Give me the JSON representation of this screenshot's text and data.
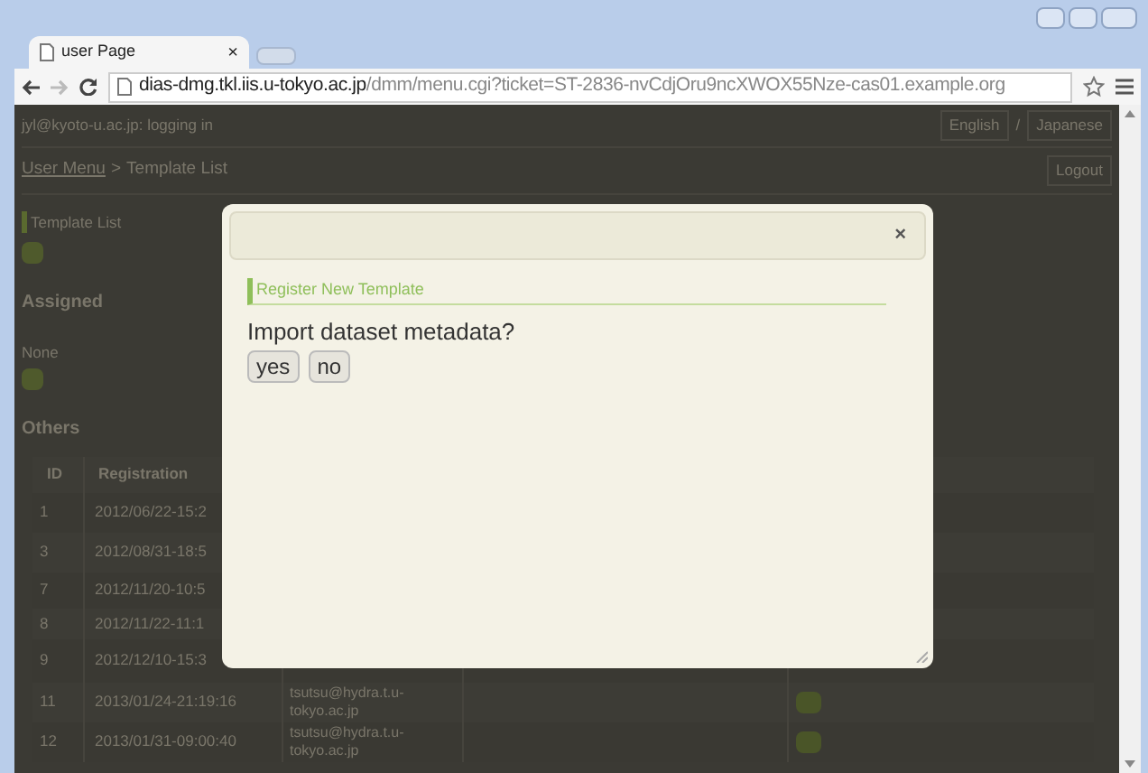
{
  "browser": {
    "tab": {
      "title": "user Page",
      "close": "×"
    },
    "url": {
      "host": "dias-dmg.tkl.iis.u-tokyo.ac.jp",
      "path": "/dmm/menu.cgi?ticket=ST-2836-nvCdjOru9ncXWOX55Nze-cas01.example.org"
    }
  },
  "page": {
    "login": "jyl@kyoto-u.ac.jp: logging in",
    "languages": [
      "English",
      "Japanese"
    ],
    "language_separator": "/",
    "breadcrumb": {
      "link": "User Menu",
      "separator": ">",
      "current": "Template List"
    },
    "logout": "Logout",
    "section_title": "Template List",
    "assigned": {
      "heading": "Assigned",
      "text": "None"
    },
    "others": {
      "heading": "Others",
      "columns": [
        "ID",
        "Registration"
      ],
      "rows": [
        {
          "id": "1",
          "date": "2012/06/22-15:2"
        },
        {
          "id": "3",
          "date": "2012/08/31-18:5"
        },
        {
          "id": "7",
          "date": "2012/11/20-10:5"
        },
        {
          "id": "8",
          "date": "2012/11/22-11:1"
        },
        {
          "id": "9",
          "date": "2012/12/10-15:3"
        },
        {
          "id": "11",
          "date": "2013/01/24-21:19:16",
          "user": "tsutsu@hydra.t.u-tokyo.ac.jp"
        },
        {
          "id": "12",
          "date": "2013/01/31-09:00:40",
          "user": "tsutsu@hydra.t.u-tokyo.ac.jp"
        }
      ]
    }
  },
  "dialog": {
    "close": "×",
    "section": "Register New Template",
    "question": "Import dataset metadata?",
    "buttons": [
      "yes",
      "no"
    ]
  }
}
